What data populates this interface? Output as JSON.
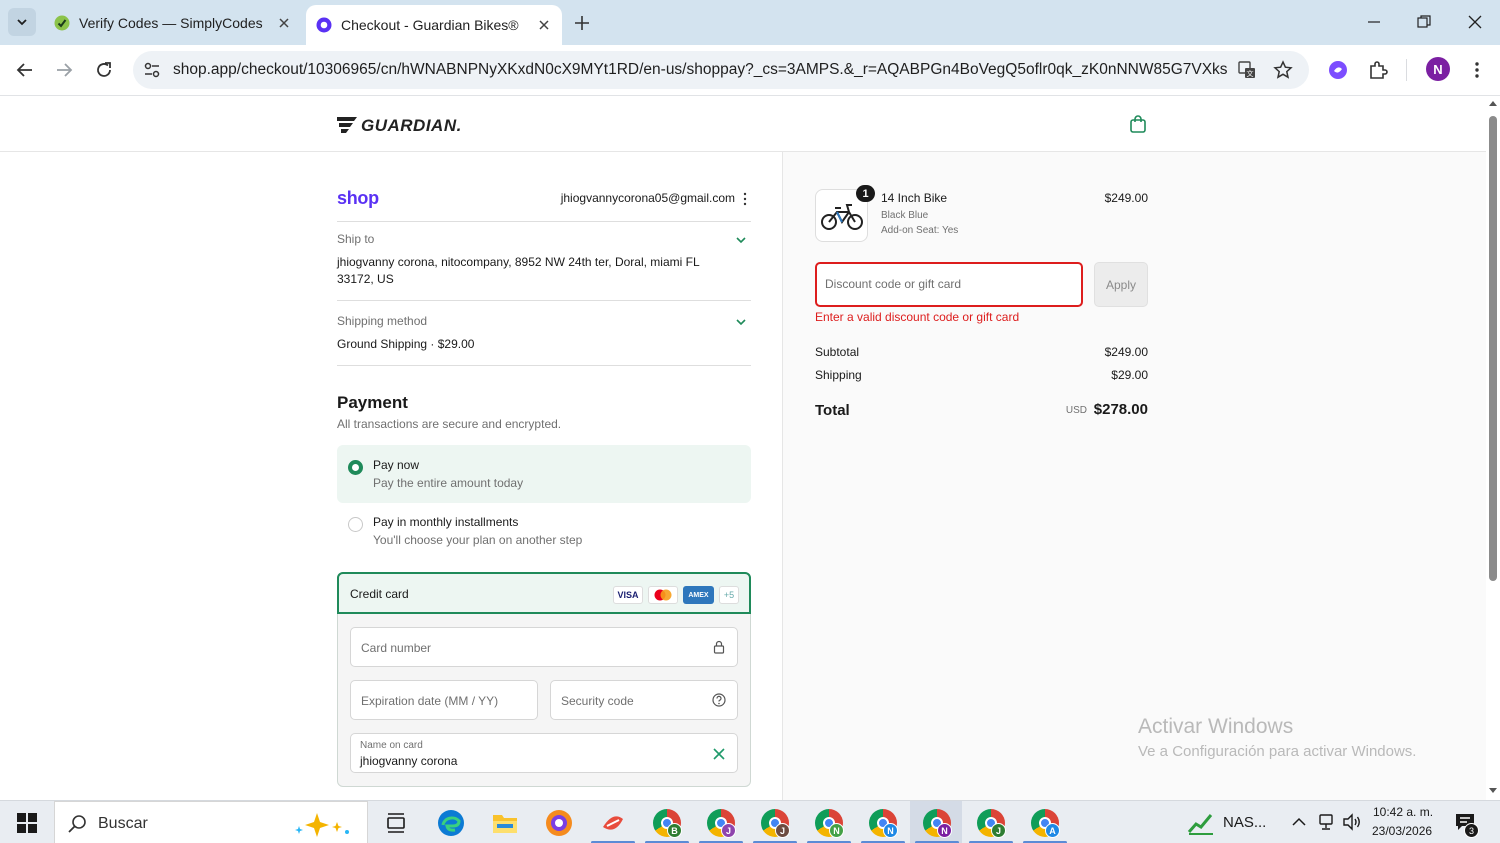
{
  "browser": {
    "tabs": [
      {
        "title": "Verify Codes — SimplyCodes",
        "active": false
      },
      {
        "title": "Checkout - Guardian Bikes®",
        "active": true
      }
    ],
    "url": "shop.app/checkout/10306965/cn/hWNABNPNyXKxdN0cX9MYt1RD/en-us/shoppay?_cs=3AMPS.&_r=AQABPGn4BoVegQ5oflr0qk_zK0nNNW85G7VXks-_v...",
    "profile_initial": "N"
  },
  "header": {
    "brand": "GUARDIAN."
  },
  "checkout": {
    "shop_logo": "shop",
    "email": "jhiogvannycorona05@gmail.com",
    "ship_to": {
      "label": "Ship to",
      "line1": "jhiogvanny corona, nitocompany, 8952 NW 24th ter, Doral, miami FL",
      "line2": "33172, US"
    },
    "shipping_method": {
      "label": "Shipping method",
      "value": "Ground Shipping · $29.00"
    },
    "payment": {
      "title": "Payment",
      "subtitle": "All transactions are secure and encrypted.",
      "options": [
        {
          "title": "Pay now",
          "subtitle": "Pay the entire amount today",
          "selected": true
        },
        {
          "title": "Pay in monthly installments",
          "subtitle": "You'll choose your plan on another step",
          "selected": false
        }
      ],
      "credit_card": {
        "title": "Credit card",
        "logos": [
          "VISA",
          "MC",
          "AMEX",
          "+5"
        ],
        "card_number_placeholder": "Card number",
        "expiration_placeholder": "Expiration date (MM / YY)",
        "security_placeholder": "Security code",
        "name_label": "Name on card",
        "name_value": "jhiogvanny corona"
      }
    }
  },
  "summary": {
    "item": {
      "qty": "1",
      "name": "14 Inch Bike",
      "variant": "Black Blue",
      "addon": "Add-on Seat: Yes",
      "price": "$249.00"
    },
    "discount_placeholder": "Discount code or gift card",
    "apply_label": "Apply",
    "discount_error": "Enter a valid discount code or gift card",
    "subtotal_label": "Subtotal",
    "subtotal_value": "$249.00",
    "shipping_label": "Shipping",
    "shipping_value": "$29.00",
    "total_label": "Total",
    "currency": "USD",
    "total_value": "$278.00"
  },
  "watermark": {
    "line1": "Activar Windows",
    "line2": "Ve a Configuración para activar Windows."
  },
  "taskbar": {
    "search_placeholder": "Buscar",
    "chrome_profiles": [
      "B",
      "J",
      "J",
      "N",
      "N",
      "N",
      "J",
      "A"
    ],
    "tray_app_label": "NAS...",
    "time": "10:42 a. m.",
    "date": "23/03/2026",
    "notification_count": "3"
  },
  "colors": {
    "accent_green": "#1f8a5a",
    "shop_purple": "#5a31f4",
    "error_red": "#dd1d1d"
  }
}
